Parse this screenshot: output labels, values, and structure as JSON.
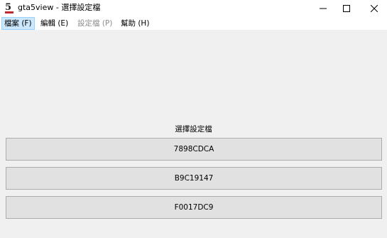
{
  "window": {
    "title": "gta5view - 選擇設定檔",
    "icon": "gta5view-app-icon",
    "controls": {
      "minimize": "minimize-icon",
      "maximize": "maximize-icon",
      "close": "close-icon"
    }
  },
  "menu": {
    "items": [
      {
        "label": "檔案 (F)",
        "state": "active"
      },
      {
        "label": "編輯 (E)",
        "state": "normal"
      },
      {
        "label": "設定檔 (P)",
        "state": "disabled"
      },
      {
        "label": "幫助 (H)",
        "state": "normal"
      }
    ]
  },
  "main": {
    "prompt": "選擇設定檔",
    "profiles": [
      {
        "label": "7898CDCA"
      },
      {
        "label": "B9C19147"
      },
      {
        "label": "F0017DC9"
      }
    ]
  },
  "colors": {
    "menu_highlight": "#cce8ff",
    "menu_highlight_border": "#99d1ff",
    "button_face": "#e1e1e1",
    "button_border": "#adadad",
    "app_icon_accent": "#c0282d"
  }
}
